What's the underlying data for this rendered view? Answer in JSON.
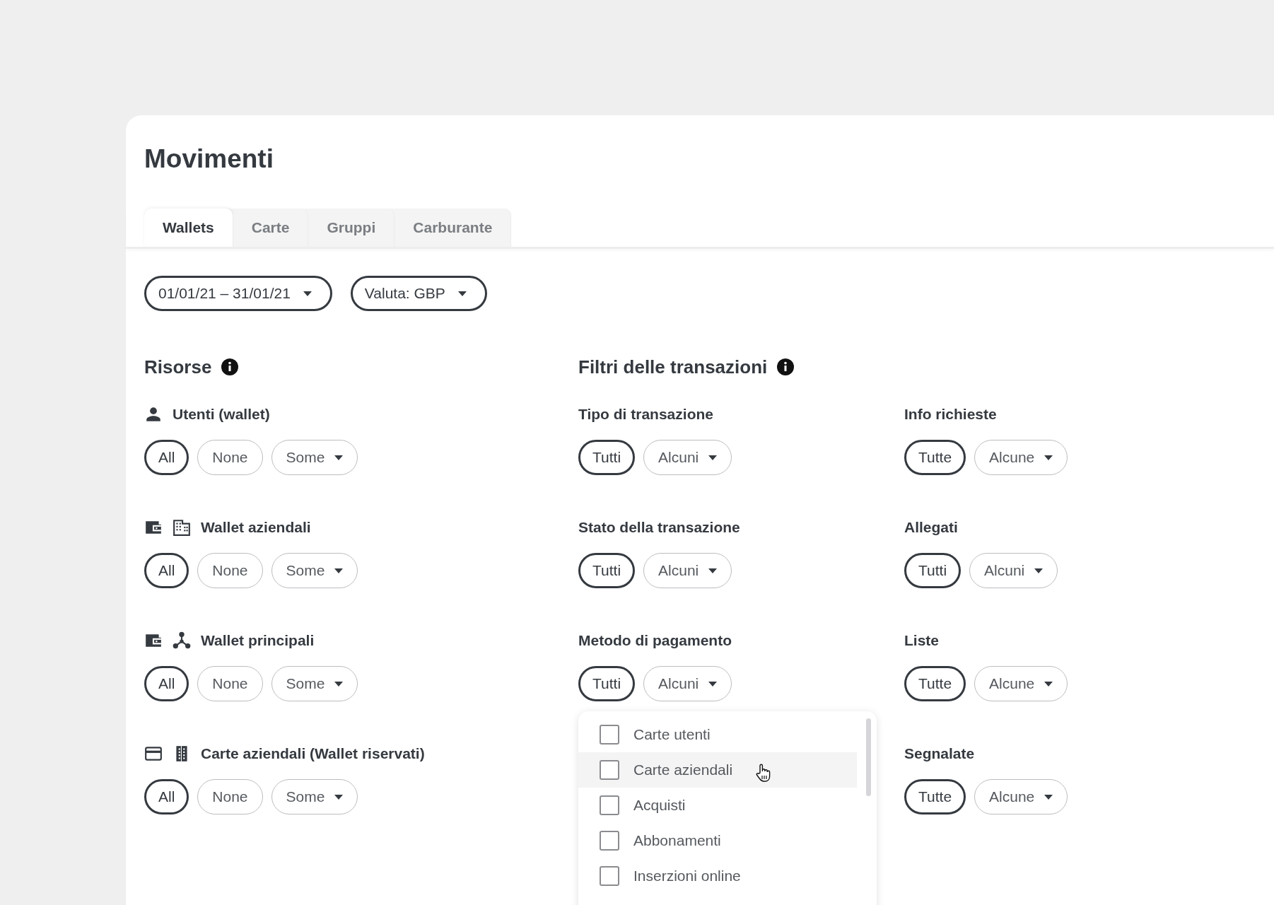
{
  "page": {
    "title": "Movimenti"
  },
  "tabs": [
    {
      "label": "Wallets",
      "selected": true
    },
    {
      "label": "Carte",
      "selected": false
    },
    {
      "label": "Gruppi",
      "selected": false
    },
    {
      "label": "Carburante",
      "selected": false
    }
  ],
  "filters": [
    {
      "label": "01/01/21 – 31/01/21"
    },
    {
      "label": "Valuta: GBP"
    }
  ],
  "resources": {
    "title": "Risorse",
    "groups": [
      {
        "kind": "users",
        "label": "Utenti (wallet)",
        "chips": [
          {
            "label": "All",
            "kind": "toggle",
            "selected": true
          },
          {
            "label": "None",
            "kind": "toggle",
            "selected": false
          },
          {
            "label": "Some",
            "kind": "dropdown",
            "selected": false
          }
        ]
      },
      {
        "kind": "company_wallets",
        "label": "Wallet aziendali",
        "chips": [
          {
            "label": "All",
            "kind": "toggle",
            "selected": true
          },
          {
            "label": "None",
            "kind": "toggle",
            "selected": false
          },
          {
            "label": "Some",
            "kind": "dropdown",
            "selected": false
          }
        ]
      },
      {
        "kind": "main_wallets",
        "label": "Wallet principali",
        "chips": [
          {
            "label": "All",
            "kind": "toggle",
            "selected": true
          },
          {
            "label": "None",
            "kind": "toggle",
            "selected": false
          },
          {
            "label": "Some",
            "kind": "dropdown",
            "selected": false
          }
        ]
      },
      {
        "kind": "company_cards",
        "label": "Carte aziendali (Wallet riservati)",
        "chips": [
          {
            "label": "All",
            "kind": "toggle",
            "selected": true
          },
          {
            "label": "None",
            "kind": "toggle",
            "selected": false
          },
          {
            "label": "Some",
            "kind": "dropdown",
            "selected": false
          }
        ]
      }
    ]
  },
  "transaction_filters": {
    "title": "Filtri delle transazioni",
    "columns": [
      {
        "groups": [
          {
            "label": "Tipo di transazione",
            "chips": [
              {
                "label": "Tutti",
                "kind": "toggle",
                "selected": true
              },
              {
                "label": "Alcuni",
                "kind": "dropdown",
                "selected": false
              }
            ]
          },
          {
            "label": "Stato della transazione",
            "chips": [
              {
                "label": "Tutti",
                "kind": "toggle",
                "selected": true
              },
              {
                "label": "Alcuni",
                "kind": "dropdown",
                "selected": false
              }
            ]
          },
          {
            "label": "Metodo di pagamento",
            "chips": [
              {
                "label": "Tutti",
                "kind": "toggle",
                "selected": true
              },
              {
                "label": "Alcuni",
                "kind": "dropdown",
                "selected": false
              }
            ],
            "menu": {
              "items": [
                {
                  "label": "Carte utenti",
                  "checked": false,
                  "hovered": false
                },
                {
                  "label": "Carte aziendali",
                  "checked": false,
                  "hovered": true
                },
                {
                  "label": "Acquisti",
                  "checked": false,
                  "hovered": false
                },
                {
                  "label": "Abbonamenti",
                  "checked": false,
                  "hovered": false
                },
                {
                  "label": "Inserzioni online",
                  "checked": false,
                  "hovered": false
                }
              ]
            }
          }
        ]
      },
      {
        "groups": [
          {
            "label": "Info richieste",
            "chips": [
              {
                "label": "Tutte",
                "kind": "toggle",
                "selected": true
              },
              {
                "label": "Alcune",
                "kind": "dropdown",
                "selected": false
              }
            ]
          },
          {
            "label": "Allegati",
            "chips": [
              {
                "label": "Tutti",
                "kind": "toggle",
                "selected": true
              },
              {
                "label": "Alcuni",
                "kind": "dropdown",
                "selected": false
              }
            ]
          },
          {
            "label": "Liste",
            "chips": [
              {
                "label": "Tutte",
                "kind": "toggle",
                "selected": true
              },
              {
                "label": "Alcune",
                "kind": "dropdown",
                "selected": false
              }
            ]
          },
          {
            "label": "Segnalate",
            "chips": [
              {
                "label": "Tutte",
                "kind": "toggle",
                "selected": true
              },
              {
                "label": "Alcune",
                "kind": "dropdown",
                "selected": false
              }
            ]
          }
        ]
      }
    ]
  }
}
